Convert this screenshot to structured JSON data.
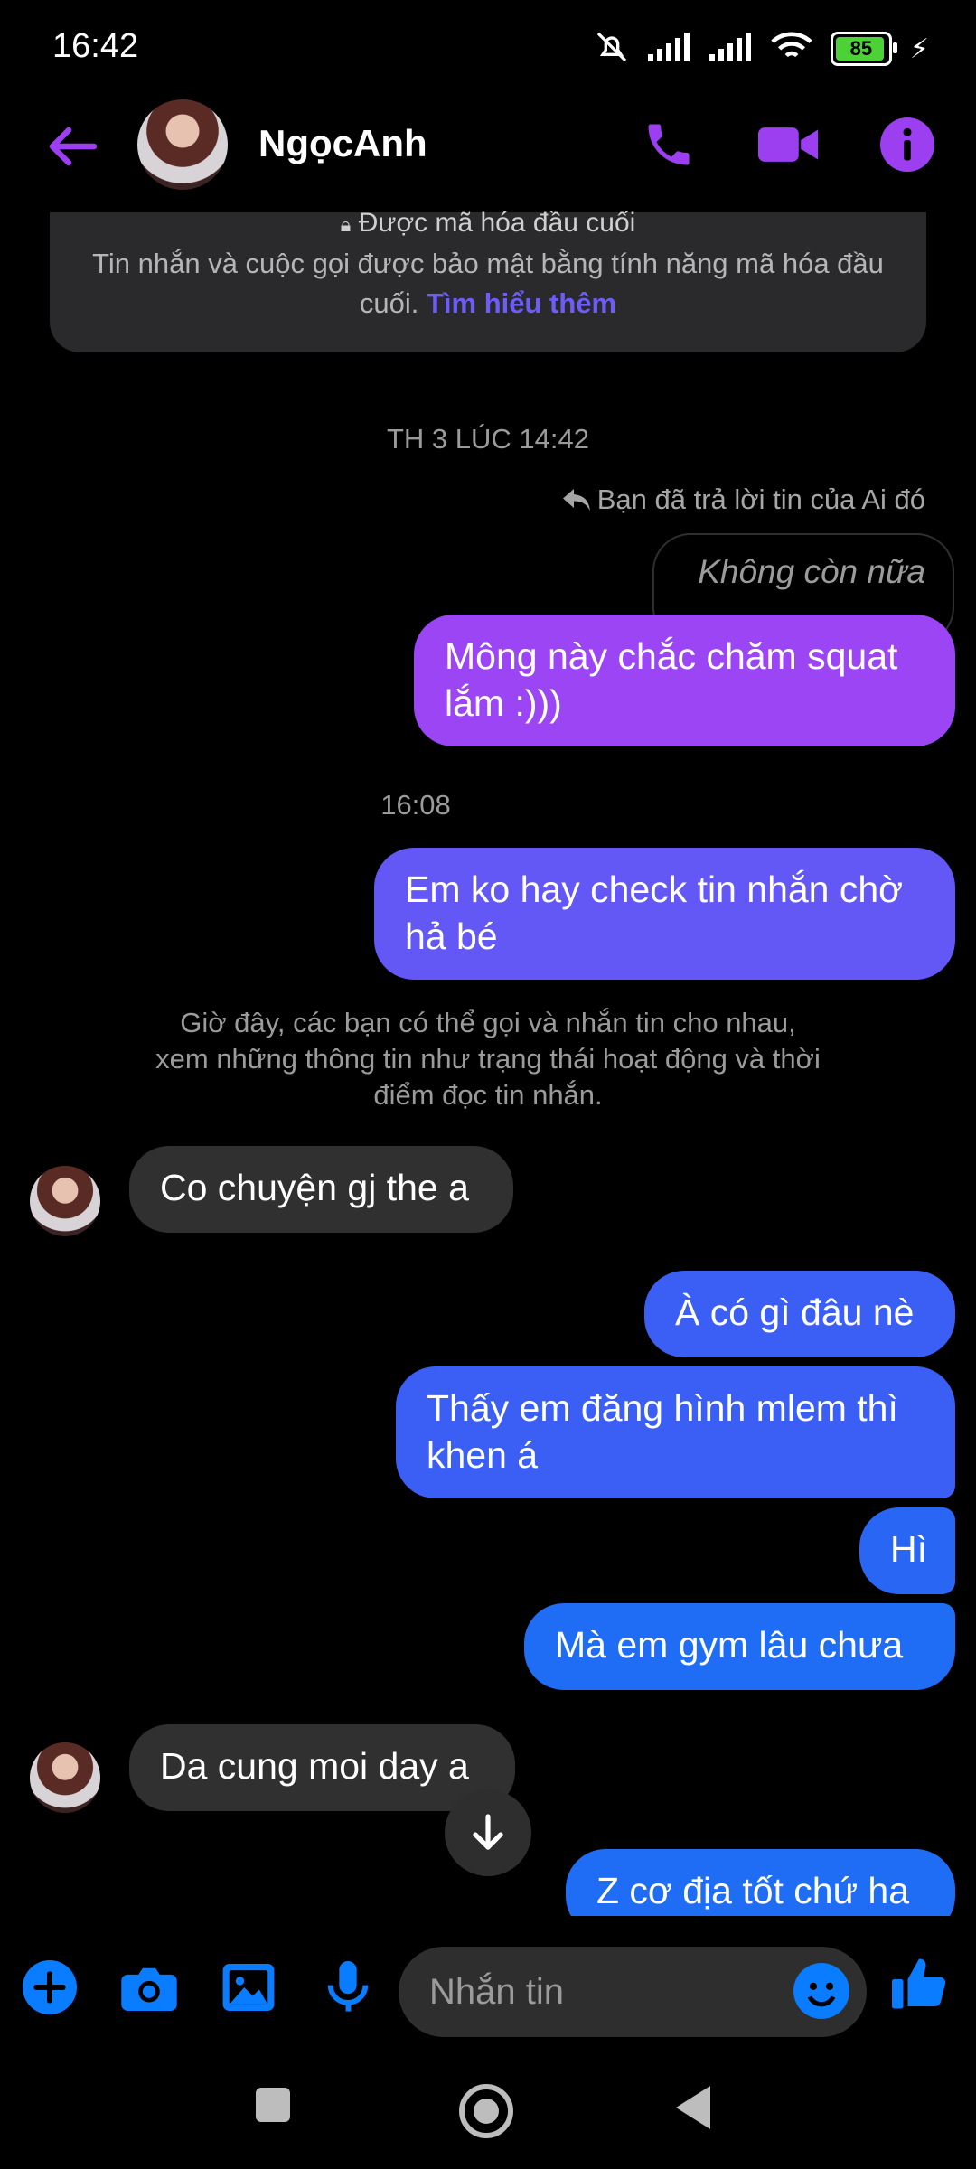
{
  "status_bar": {
    "time": "16:42",
    "battery": "85"
  },
  "header": {
    "contact_name": "NgọcAnh"
  },
  "encryption": {
    "title": "Được mã hóa đầu cuối",
    "body": "Tin nhắn và cuộc gọi được bảo mật bằng tính năng mã hóa đầu cuối.",
    "link": "Tìm hiểu thêm"
  },
  "thread": {
    "timestamp_1": "TH 3 LÚC 14:42",
    "reply_label": "Bạn đã trả lời tin của Ai đó",
    "quoted_text": "Không còn nữa",
    "msg_1": "Mông này chắc chăm squat lắm :)))",
    "timestamp_2": "16:08",
    "msg_2": "Em ko hay check tin nhắn chờ hả bé",
    "system_note": "Giờ đây, các bạn có thể gọi và nhắn tin cho nhau, xem những thông tin như trạng thái hoạt động và thời điểm đọc tin nhắn.",
    "msg_3": "Co chuyện gj the a",
    "msg_4": "À có gì đâu nè",
    "msg_5": "Thấy em đăng hình mlem thì khen á",
    "msg_6": "Hì",
    "msg_7": "Mà em gym lâu chưa",
    "msg_8": "Da cung moi day a",
    "msg_9": "Z cơ địa tốt chứ ha"
  },
  "composer": {
    "placeholder": "Nhắn tin"
  },
  "colors": {
    "accent_purple": "#9b3ff0",
    "accent_blue": "#0a7cff",
    "sent_gradient": [
      "#9b45f4",
      "#6357f5",
      "#3b5ff4",
      "#1f6df5"
    ]
  }
}
